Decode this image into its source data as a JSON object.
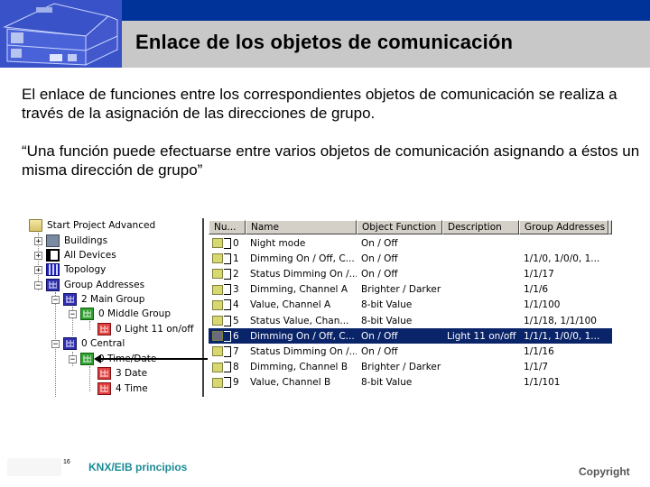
{
  "header": {
    "title": "Enlace de los objetos de comunicación",
    "logo_icon": "house-cutaway-illustration"
  },
  "body": {
    "paragraph1": "El enlace de funciones entre los correspondientes objetos de comunicación se realiza a través de la asignación de las direcciones de grupo.",
    "paragraph2": "“Una función puede efectuarse entre varios objetos de comunicación asignando a éstos un misma dirección de grupo”"
  },
  "tree": {
    "nodes": [
      {
        "label": "Start Project Advanced",
        "icon": "folder-icon",
        "expander": ""
      },
      {
        "label": "Buildings",
        "icon": "buildings-icon",
        "expander": "+"
      },
      {
        "label": "All Devices",
        "icon": "devices-icon",
        "expander": "+"
      },
      {
        "label": "Topology",
        "icon": "topology-icon",
        "expander": "+"
      },
      {
        "label": "Group Addresses",
        "icon": "group-addresses-icon",
        "expander": "−"
      },
      {
        "label": "2 Main Group",
        "icon": "main-group-icon",
        "expander": "−"
      },
      {
        "label": "0 Middle Group",
        "icon": "middle-group-icon",
        "expander": "−"
      },
      {
        "label": "0 Light 11 on/off",
        "icon": "group-address-icon",
        "expander": ""
      },
      {
        "label": "0 Central",
        "icon": "main-group-icon",
        "expander": "−"
      },
      {
        "label": "0 Time/Date",
        "icon": "middle-group-icon",
        "expander": "−"
      },
      {
        "label": "3 Date",
        "icon": "group-address-icon",
        "expander": ""
      },
      {
        "label": "4 Time",
        "icon": "group-address-icon",
        "expander": ""
      }
    ]
  },
  "table": {
    "columns": [
      "Nu...",
      "Name",
      "Object Function",
      "Description",
      "Group Addresses"
    ],
    "rows": [
      {
        "num": "0",
        "name": "Night mode",
        "func": "On / Off",
        "desc": "",
        "ga": ""
      },
      {
        "num": "1",
        "name": "Dimming On / Off, C...",
        "func": "On / Off",
        "desc": "",
        "ga": "1/1/0, 1/0/0, 1..."
      },
      {
        "num": "2",
        "name": "Status Dimming On /...",
        "func": "On / Off",
        "desc": "",
        "ga": "1/1/17"
      },
      {
        "num": "3",
        "name": "Dimming, Channel A",
        "func": "Brighter / Darker",
        "desc": "",
        "ga": "1/1/6"
      },
      {
        "num": "4",
        "name": "Value, Channel A",
        "func": "8-bit Value",
        "desc": "",
        "ga": "1/1/100"
      },
      {
        "num": "5",
        "name": "Status Value, Chan...",
        "func": "8-bit Value",
        "desc": "",
        "ga": "1/1/18, 1/1/100"
      },
      {
        "num": "6",
        "name": "Dimming On / Off, C...",
        "func": "On / Off",
        "desc": "Light 11 on/off",
        "ga": "1/1/1, 1/0/0, 1...",
        "selected": true
      },
      {
        "num": "7",
        "name": "Status Dimming On /...",
        "func": "On / Off",
        "desc": "",
        "ga": "1/1/16"
      },
      {
        "num": "8",
        "name": "Dimming, Channel B",
        "func": "Brighter / Darker",
        "desc": "",
        "ga": "1/1/7"
      },
      {
        "num": "9",
        "name": "Value, Channel B",
        "func": "8-bit Value",
        "desc": "",
        "ga": "1/1/101"
      }
    ]
  },
  "footer": {
    "page_number": "16",
    "left_label": "KNX/EIB principios",
    "right_label": "Copyright"
  },
  "colors": {
    "header_blue": "#003399",
    "header_gray": "#c8c8c8",
    "selection": "#0a246a",
    "footer_teal": "#1a8a96"
  }
}
